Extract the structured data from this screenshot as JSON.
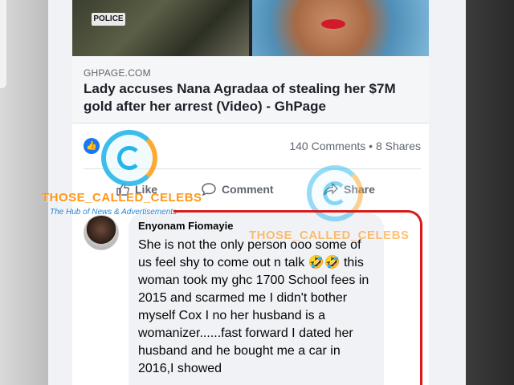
{
  "preview": {
    "domain": "GHPAGE.COM",
    "title": "Lady accuses Nana Agradaa of stealing her $7M gold after her arrest (Video) - GhPage",
    "image_text": "POLICE"
  },
  "stats": {
    "counts": "140 Comments • 8 Shares"
  },
  "actions": {
    "like": "Like",
    "comment": "Comment",
    "share": "Share"
  },
  "comment": {
    "author": "Enyonam Fiomayie",
    "text": "She is not the only person ooo some of us feel shy to come out n talk 🤣🤣 this woman took my ghc 1700 School fees in 2015 and scarmed me I didn't bother myself Cox I no her husband is a womanizer......fast forward I dated her husband and he bought me a car in 2016,I showed"
  },
  "watermark": {
    "text": "THOSE_CALLED_CELEBS",
    "subtitle": "The Hub of News & Advertisements"
  },
  "colors": {
    "accent": "#1877f2",
    "annotation": "#d61a1a",
    "watermark": "#ff8c00"
  },
  "icons": {
    "like": "thumbs-up-icon",
    "comment": "speech-bubble-icon",
    "share": "share-arrow-icon"
  }
}
